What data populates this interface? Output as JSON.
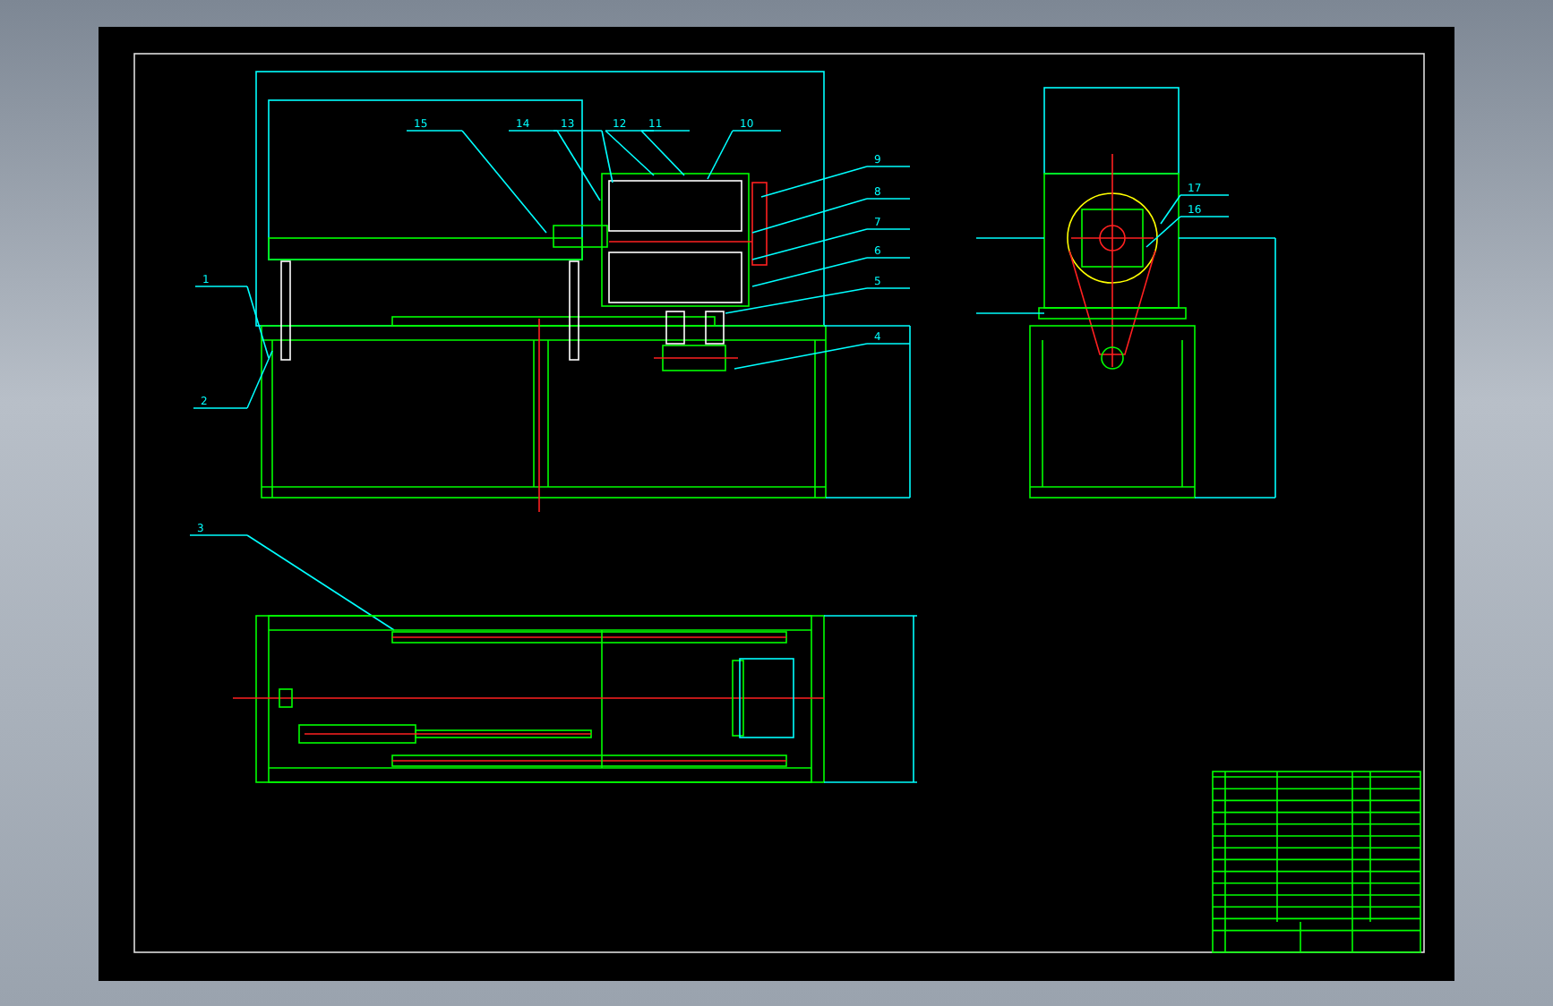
{
  "front_view": {
    "part_numbers": [
      {
        "text": "15"
      },
      {
        "text": "14"
      },
      {
        "text": "13"
      },
      {
        "text": "12"
      },
      {
        "text": "11"
      },
      {
        "text": "10"
      },
      {
        "text": "9"
      },
      {
        "text": "8"
      },
      {
        "text": "7"
      },
      {
        "text": "6"
      },
      {
        "text": "1"
      },
      {
        "text": "5"
      },
      {
        "text": "4"
      },
      {
        "text": "2"
      },
      {
        "text": "3"
      }
    ]
  },
  "side_view": {
    "part_numbers": [
      {
        "text": "17"
      },
      {
        "text": "16"
      }
    ]
  }
}
